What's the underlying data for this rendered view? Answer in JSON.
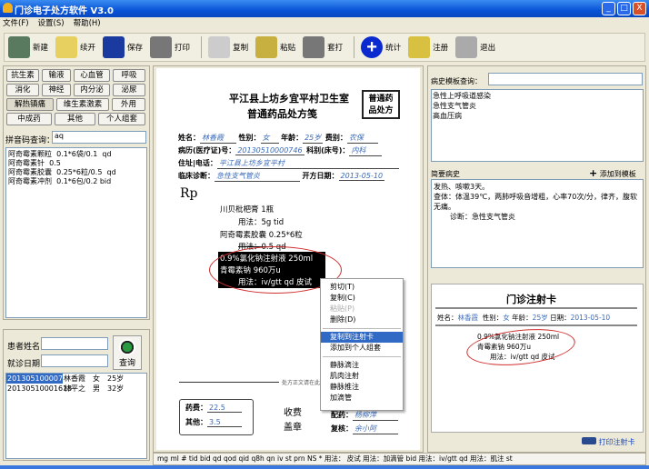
{
  "window": {
    "title": "门诊电子处方软件 V3.0",
    "buttons": [
      "_",
      "□",
      "X"
    ]
  },
  "menu": [
    "文件(F)",
    "设置(S)",
    "帮助(H)"
  ],
  "toolbar": [
    {
      "label": "新建",
      "icon": "new-icon",
      "color": "#5a7a60"
    },
    {
      "label": "续开",
      "icon": "folder-icon",
      "color": "#e8d060"
    },
    {
      "label": "保存",
      "icon": "save-icon",
      "color": "#1a3aa0"
    },
    {
      "label": "打印",
      "icon": "printer-icon",
      "color": "#777"
    },
    {
      "label": "复制",
      "icon": "copy-icon",
      "color": "#ccc"
    },
    {
      "label": "粘贴",
      "icon": "paste-icon",
      "color": "#c8b040"
    },
    {
      "label": "套打",
      "icon": "printer-icon",
      "color": "#777"
    },
    {
      "label": "统计",
      "icon": "plus-circle-icon",
      "color": "#0a2ad0"
    },
    {
      "label": "注册",
      "icon": "key-icon",
      "color": "#d8c040"
    },
    {
      "label": "退出",
      "icon": "plane-icon",
      "color": "#aaa"
    }
  ],
  "categories": [
    "抗生素",
    "输液",
    "心血管",
    "呼吸",
    "消化",
    "神经",
    "内分泌",
    "泌尿",
    "解热镇痛",
    "维生素激素",
    "外用",
    "中成药",
    "其他",
    "个人组套"
  ],
  "pinyin": {
    "label": "拼音码查询：",
    "value": "aq"
  },
  "drug_list": [
    "阿奇霉素颗粒  0.1*6袋/0.1  qd",
    "阿奇霉素针  0.5",
    "阿奇霉素胶囊  0.25*6粒/0.5  qd",
    "阿奇霉素冲剂  0.1*6包/0.2 bid"
  ],
  "patient_search": {
    "name_label": "患者姓名",
    "date_label": "就诊日期",
    "name_value": "",
    "date_value": "",
    "query_label": "查询"
  },
  "patients": [
    [
      "20130510000746",
      "林香霞",
      "女",
      "25岁"
    ],
    [
      "20130510001613",
      "林平之",
      "男",
      "32岁"
    ]
  ],
  "prescription": {
    "clinic": "平江县上坊乡宜平村卫生室",
    "title": "普通药品处方笺",
    "stamp": "普通药品处方",
    "name_label": "姓名：",
    "name": "林香霞",
    "sex_label": "性别：",
    "sex": "女",
    "age_label": "年龄：",
    "age": "25岁",
    "fee_label": "费别：",
    "fee": "农保",
    "record_label": "病历(医疗证)号：",
    "record": "20130510000746",
    "dept_label": "科别(床号)：",
    "dept": "内科",
    "address_label": "住址|电话：",
    "address": "平江县上坊乡宜平村",
    "diag_label": "临床诊断：",
    "diag": "急性支气管炎",
    "date_label": "开方日期：",
    "date": "2013-05-10",
    "rp": "Rp",
    "lines": [
      "川贝枇杷膏  1瓶",
      "用法：5g tid",
      "阿奇霉素胶囊  0.25*6粒",
      "用法：0.5   qd"
    ],
    "selected": [
      "0.9%氯化钠注射液  250ml",
      "青霉素钠  960万u",
      "用法：iv/gtt qd 皮试"
    ],
    "divider_text": "处方正文请在此以上",
    "drug_fee_label": "药费：",
    "drug_fee": "22.5",
    "other_label": "其他：",
    "other": "3.5",
    "charge": "收费",
    "seal": "盖章",
    "dispense_label": "配药：",
    "dispense": "杨柳萍",
    "check_label": "复核：",
    "check": "余小阿"
  },
  "context_menu": {
    "items": [
      "剪切(T)",
      "复制(C)",
      "粘贴(P)",
      "删除(D)"
    ],
    "items2": [
      "复制到注射卡",
      "添加到个人组套"
    ],
    "items3": [
      "静脉滴注",
      "肌肉注射",
      "静脉推注",
      "加滴管"
    ],
    "highlighted": "复制到注射卡"
  },
  "history": {
    "search_label": "病史模板查询：",
    "search_value": "",
    "templates": [
      "急性上呼吸道感染",
      "急性支气管炎",
      "高血压病"
    ],
    "brief_label": "简要病史",
    "add_label": "添加到模板",
    "text": [
      "发热、咳嗽3天。",
      "查体：体温39℃，两肺呼吸音增粗，心率70次/分，律齐，腹软无痛。",
      "诊断：急性支气管炎"
    ]
  },
  "injection_card": {
    "title": "门诊注射卡",
    "name_label": "姓名：",
    "name": "林香霞",
    "sex_label": "性别：",
    "sex": "女",
    "age_label": "年龄：",
    "age": "25岁",
    "date_label": "日期：",
    "date": "2013-05-10",
    "lines": [
      "0.9%氯化钠注射液  250ml",
      "青霉素钠  960万u",
      "用法：iv/gtt qd 皮试"
    ],
    "print_label": "打印注射卡"
  },
  "statusbar": "mg  ml  #  tid  bid  qd  qod  qid  q8h  qn  iv  st  prn  NS  *  用法：  皮试  用法：加滴管 bid  用法：iv/gtt qd  用法：肌注 st"
}
